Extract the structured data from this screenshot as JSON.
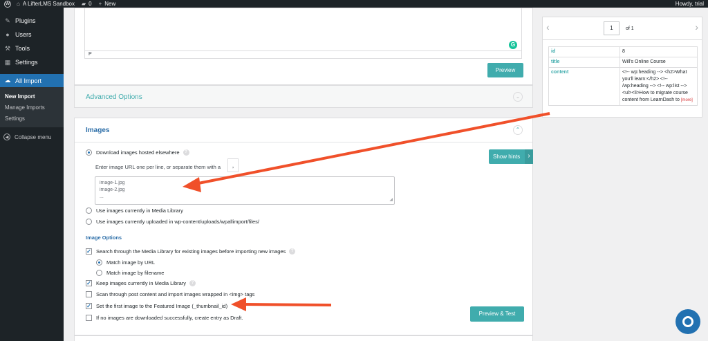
{
  "adminbar": {
    "site_name": "A LifterLMS Sandbox",
    "comments_count": "0",
    "new_label": "New",
    "howdy": "Howdy, trial"
  },
  "sidebar": {
    "items": [
      {
        "label": "Plugins",
        "icon": "plug-icon"
      },
      {
        "label": "Users",
        "icon": "users-icon"
      },
      {
        "label": "Tools",
        "icon": "wrench-icon"
      },
      {
        "label": "Settings",
        "icon": "settings-icon"
      }
    ],
    "active": {
      "label": "All Import",
      "icon": "all-import-icon"
    },
    "submenu": [
      "New Import",
      "Manage Imports",
      "Settings"
    ],
    "collapse_label": "Collapse menu"
  },
  "editor": {
    "path_tag": "P",
    "preview_label": "Preview"
  },
  "advanced": {
    "title": "Advanced Options"
  },
  "images": {
    "title": "Images",
    "download_option": "Download images hosted elsewhere",
    "enter_urls_text": "Enter image URL one per line, or separate them with a",
    "separator": ",",
    "url_lines": [
      "image-1.jpg",
      "image-2.jpg",
      "..."
    ],
    "media_library_option": "Use images currently in Media Library",
    "uploaded_option": "Use images currently uploaded in wp-content/uploads/wpallimport/files/",
    "image_options_heading": "Image Options",
    "search_media_option": "Search through the Media Library for existing images before importing new images",
    "match_url": "Match image by URL",
    "match_filename": "Match image by filename",
    "keep_images": "Keep images currently in Media Library",
    "scan_content": "Scan through post content and import images wrapped in <img> tags",
    "featured_image": "Set the first image to the Featured Image (_thumbnail_id)",
    "draft_option": "If no images are downloaded successfully, create entry as Draft.",
    "preview_test_label": "Preview & Test",
    "show_hints_label": "Show hints"
  },
  "record_preview": {
    "page": "1",
    "of_label": "of 1",
    "rows": [
      {
        "key": "id",
        "value": "8"
      },
      {
        "key": "title",
        "value": "Will's Online Course"
      },
      {
        "key": "content",
        "value": "<!-- wp:heading --> <h2>What you'll learn:</h2> <!-- /wp:heading --> <!-- wp:list --> <ul><li>How to migrate course content from LearnDash to"
      }
    ],
    "more_label": "[more]"
  },
  "colors": {
    "accent_teal": "#40acad",
    "wp_blue": "#2271b1",
    "arrow_red": "#f0502a",
    "admin_dark": "#1d2327"
  }
}
